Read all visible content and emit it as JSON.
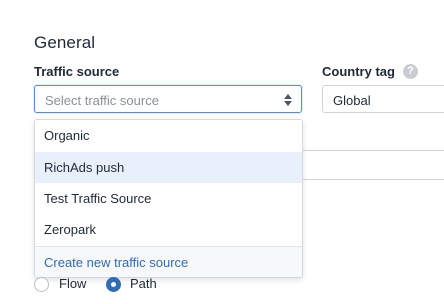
{
  "section": {
    "title": "General"
  },
  "traffic_source": {
    "label": "Traffic source",
    "placeholder": "Select traffic source",
    "options": [
      "Organic",
      "RichAds push",
      "Test Traffic Source",
      "Zeropark"
    ],
    "create_link": "Create new traffic source"
  },
  "country_tag": {
    "label": "Country tag",
    "value": "Global",
    "help_icon": "?"
  },
  "mode": {
    "options": [
      "Flow",
      "Path"
    ],
    "selected": "Path"
  },
  "colors": {
    "accent": "#2f6db5",
    "hover_bg": "#e8f0fb"
  }
}
